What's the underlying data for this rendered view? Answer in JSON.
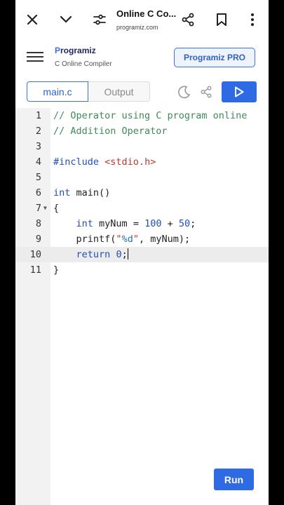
{
  "browser": {
    "title": "Online C Co...",
    "url": "programiz.com"
  },
  "header": {
    "logo_text": "rogramiz",
    "logo_initial": "P",
    "subtitle": "C Online Compiler",
    "pro_button": "Programiz PRO"
  },
  "tabs": [
    {
      "label": "main.c",
      "active": true
    },
    {
      "label": "Output",
      "active": false
    }
  ],
  "editor": {
    "active_line": 10,
    "lines": [
      {
        "n": "1",
        "fold": false
      },
      {
        "n": "2",
        "fold": false
      },
      {
        "n": "3",
        "fold": false
      },
      {
        "n": "4",
        "fold": false
      },
      {
        "n": "5",
        "fold": false
      },
      {
        "n": "6",
        "fold": false
      },
      {
        "n": "7",
        "fold": true
      },
      {
        "n": "8",
        "fold": false
      },
      {
        "n": "9",
        "fold": false
      },
      {
        "n": "10",
        "fold": false
      },
      {
        "n": "11",
        "fold": false
      }
    ],
    "tokens": {
      "l1": "// Operator using C program online",
      "l2": "// Addition Operator",
      "l4_kw": "#include",
      "l4_str": "<stdio.h>",
      "l6_kw": "int",
      "l6_rest": "main()",
      "l7": "{",
      "l8_kw": "int",
      "l8_a": "myNum = ",
      "l8_n1": "100",
      "l8_b": " + ",
      "l8_n2": "50",
      "l8_c": ";",
      "l9_a": "printf(",
      "l9_q1": "\"",
      "l9_fmt": "%d",
      "l9_q2": "\"",
      "l9_b": ", myNum);",
      "l10_kw": "return",
      "l10_sp": " ",
      "l10_n": "0",
      "l10_c": ";",
      "l11": "}"
    }
  },
  "run_button": "Run",
  "colors": {
    "accent": "#2d6ae3",
    "comment": "#3f8a5a",
    "keyword": "#1f4fb8",
    "string": "#b83a2a"
  },
  "icons": [
    "close-icon",
    "chevron-down-icon",
    "tune-icon",
    "share-icon",
    "bookmark-icon",
    "more-vert-icon",
    "menu-icon",
    "moon-icon",
    "play-icon"
  ]
}
